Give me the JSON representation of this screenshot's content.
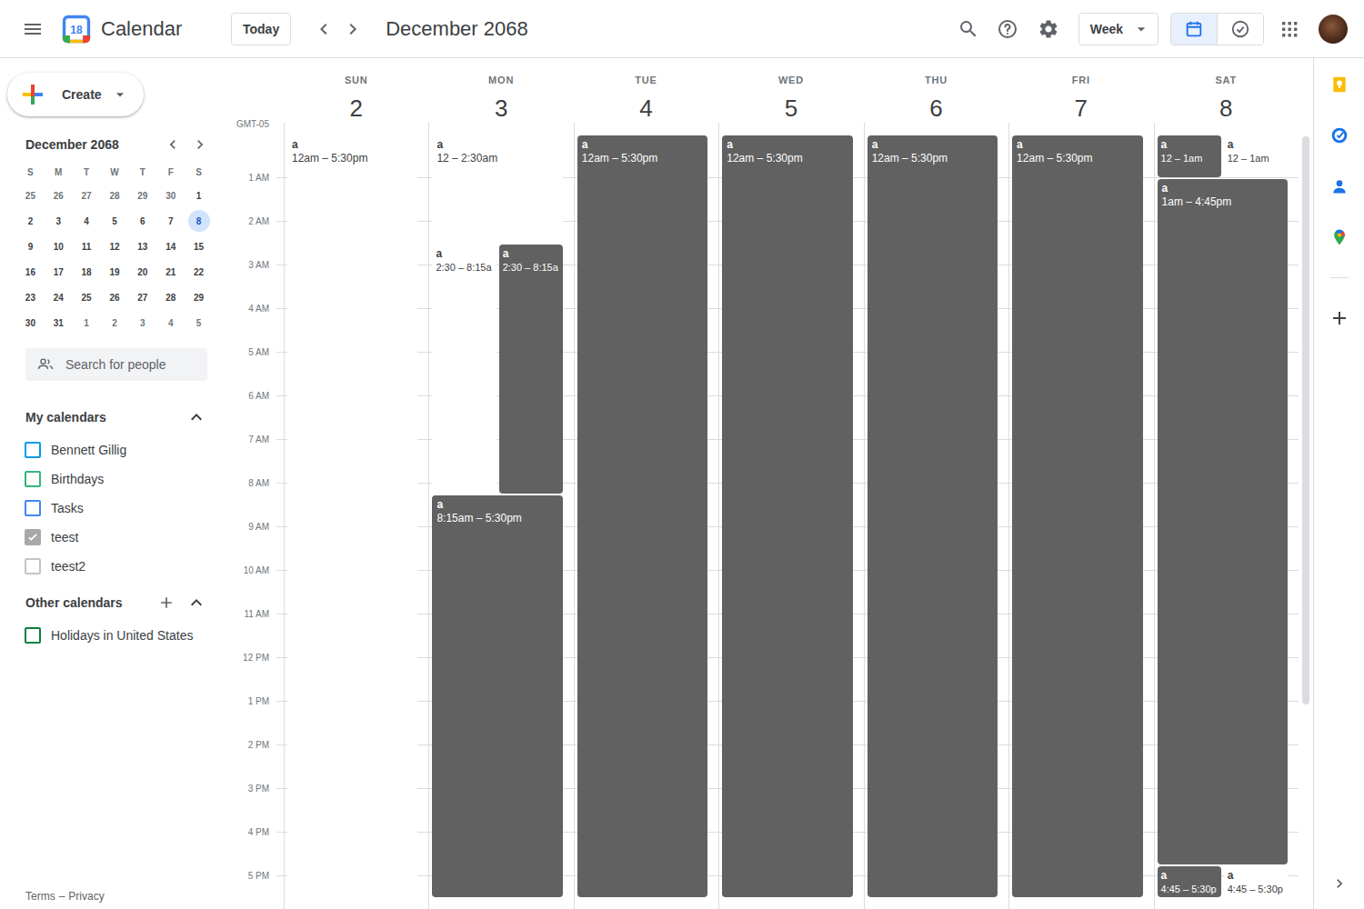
{
  "app": {
    "name": "Calendar",
    "logo_day": "18"
  },
  "toolbar": {
    "today": "Today",
    "period": "December 2068",
    "view": "Week",
    "view_toggle": [
      {
        "kind": "calendar",
        "selected": true
      },
      {
        "kind": "tasks",
        "selected": false
      }
    ]
  },
  "create": {
    "label": "Create"
  },
  "mini_calendar": {
    "title": "December 2068",
    "weekdays": [
      "S",
      "M",
      "T",
      "W",
      "T",
      "F",
      "S"
    ],
    "weeks": [
      [
        {
          "day": "25",
          "muted": true,
          "selected": false
        },
        {
          "day": "26",
          "muted": true,
          "selected": false
        },
        {
          "day": "27",
          "muted": true,
          "selected": false
        },
        {
          "day": "28",
          "muted": true,
          "selected": false
        },
        {
          "day": "29",
          "muted": true,
          "selected": false
        },
        {
          "day": "30",
          "muted": true,
          "selected": false
        },
        {
          "day": "1",
          "muted": false,
          "selected": false
        }
      ],
      [
        {
          "day": "2",
          "muted": false,
          "selected": false
        },
        {
          "day": "3",
          "muted": false,
          "selected": false
        },
        {
          "day": "4",
          "muted": false,
          "selected": false
        },
        {
          "day": "5",
          "muted": false,
          "selected": false
        },
        {
          "day": "6",
          "muted": false,
          "selected": false
        },
        {
          "day": "7",
          "muted": false,
          "selected": false
        },
        {
          "day": "8",
          "muted": false,
          "selected": true
        }
      ],
      [
        {
          "day": "9",
          "muted": false,
          "selected": false
        },
        {
          "day": "10",
          "muted": false,
          "selected": false
        },
        {
          "day": "11",
          "muted": false,
          "selected": false
        },
        {
          "day": "12",
          "muted": false,
          "selected": false
        },
        {
          "day": "13",
          "muted": false,
          "selected": false
        },
        {
          "day": "14",
          "muted": false,
          "selected": false
        },
        {
          "day": "15",
          "muted": false,
          "selected": false
        }
      ],
      [
        {
          "day": "16",
          "muted": false,
          "selected": false
        },
        {
          "day": "17",
          "muted": false,
          "selected": false
        },
        {
          "day": "18",
          "muted": false,
          "selected": false
        },
        {
          "day": "19",
          "muted": false,
          "selected": false
        },
        {
          "day": "20",
          "muted": false,
          "selected": false
        },
        {
          "day": "21",
          "muted": false,
          "selected": false
        },
        {
          "day": "22",
          "muted": false,
          "selected": false
        }
      ],
      [
        {
          "day": "23",
          "muted": false,
          "selected": false
        },
        {
          "day": "24",
          "muted": false,
          "selected": false
        },
        {
          "day": "25",
          "muted": false,
          "selected": false
        },
        {
          "day": "26",
          "muted": false,
          "selected": false
        },
        {
          "day": "27",
          "muted": false,
          "selected": false
        },
        {
          "day": "28",
          "muted": false,
          "selected": false
        },
        {
          "day": "29",
          "muted": false,
          "selected": false
        }
      ],
      [
        {
          "day": "30",
          "muted": false,
          "selected": false
        },
        {
          "day": "31",
          "muted": false,
          "selected": false
        },
        {
          "day": "1",
          "muted": true,
          "selected": false
        },
        {
          "day": "2",
          "muted": true,
          "selected": false
        },
        {
          "day": "3",
          "muted": true,
          "selected": false
        },
        {
          "day": "4",
          "muted": true,
          "selected": false
        },
        {
          "day": "5",
          "muted": true,
          "selected": false
        }
      ]
    ]
  },
  "people_search": {
    "placeholder": "Search for people"
  },
  "my_calendars": {
    "title": "My calendars",
    "expanded": true,
    "items": [
      {
        "name": "Bennett Gillig",
        "checked": false,
        "color": "#039be5"
      },
      {
        "name": "Birthdays",
        "checked": false,
        "color": "#33b679"
      },
      {
        "name": "Tasks",
        "checked": false,
        "color": "#4285f4"
      },
      {
        "name": "teest",
        "checked": true,
        "color": "#a8a8a8"
      },
      {
        "name": "teest2",
        "checked": false,
        "color": "#c4c4c4"
      }
    ]
  },
  "other_calendars": {
    "title": "Other calendars",
    "expanded": true,
    "items": [
      {
        "name": "Holidays in United States",
        "checked": false,
        "color": "#0b8043"
      }
    ]
  },
  "footer": {
    "links": [
      "Terms",
      "Privacy"
    ],
    "separator": "–"
  },
  "week": {
    "timezone": "GMT-05",
    "days": [
      {
        "name": "SUN",
        "date": "2"
      },
      {
        "name": "MON",
        "date": "3"
      },
      {
        "name": "TUE",
        "date": "4"
      },
      {
        "name": "WED",
        "date": "5"
      },
      {
        "name": "THU",
        "date": "6"
      },
      {
        "name": "FRI",
        "date": "7"
      },
      {
        "name": "SAT",
        "date": "8"
      }
    ],
    "hours": [
      "1 AM",
      "2 AM",
      "3 AM",
      "4 AM",
      "5 AM",
      "6 AM",
      "7 AM",
      "8 AM",
      "9 AM",
      "10 AM",
      "11 AM",
      "12 PM",
      "1 PM",
      "2 PM",
      "3 PM",
      "4 PM",
      "5 PM"
    ],
    "events": [
      {
        "day": 0,
        "title": "a",
        "time": "12am – 5:30pm",
        "start": 0,
        "end": 17.5,
        "color": "#ffffff"
      },
      {
        "day": 1,
        "title": "a",
        "time": "12 – 2:30am",
        "start": 0,
        "end": 2.5,
        "color": "#ffffff"
      },
      {
        "day": 1,
        "title": "a",
        "time": "2:30 – 8:15a",
        "start": 2.5,
        "end": 8.25,
        "color": "#ffffff"
      },
      {
        "day": 1,
        "title": "a",
        "time": "2:30 – 8:15a",
        "start": 2.5,
        "end": 8.25,
        "color": "#616161"
      },
      {
        "day": 1,
        "title": "a",
        "time": "8:15am – 5:30pm",
        "start": 8.25,
        "end": 17.5,
        "color": "#616161"
      },
      {
        "day": 2,
        "title": "a",
        "time": "12am – 5:30pm",
        "start": 0,
        "end": 17.5,
        "color": "#616161"
      },
      {
        "day": 3,
        "title": "a",
        "time": "12am – 5:30pm",
        "start": 0,
        "end": 17.5,
        "color": "#616161"
      },
      {
        "day": 4,
        "title": "a",
        "time": "12am – 5:30pm",
        "start": 0,
        "end": 17.5,
        "color": "#616161"
      },
      {
        "day": 5,
        "title": "a",
        "time": "12am – 5:30pm",
        "start": 0,
        "end": 17.5,
        "color": "#616161"
      },
      {
        "day": 6,
        "title": "a",
        "time": "12 – 1am",
        "start": 0,
        "end": 1,
        "color": "#616161"
      },
      {
        "day": 6,
        "title": "a",
        "time": "12 – 1am",
        "start": 0,
        "end": 1,
        "color": "#ffffff"
      },
      {
        "day": 6,
        "title": "a",
        "time": "1am – 4:45pm",
        "start": 1,
        "end": 16.75,
        "color": "#616161"
      },
      {
        "day": 6,
        "title": "a",
        "time": "4:45 – 5:30p",
        "start": 16.75,
        "end": 17.5,
        "color": "#616161"
      },
      {
        "day": 6,
        "title": "a",
        "time": "4:45 – 5:30p",
        "start": 16.75,
        "end": 17.5,
        "color": "#ffffff"
      }
    ]
  }
}
